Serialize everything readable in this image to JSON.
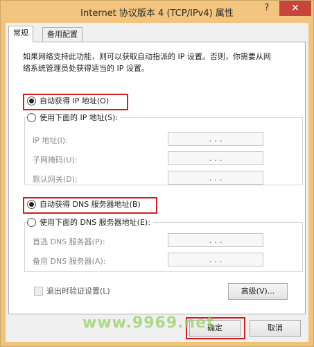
{
  "window": {
    "title": "Internet 协议版本 4 (TCP/IPv4) 属性",
    "help": "?",
    "close": "✕"
  },
  "tabs": [
    "常规",
    "备用配置"
  ],
  "description_lines": [
    "如果网络支持此功能，则可以获取自动指派的 IP 设置。否则，你需要从网",
    "络系统管理员处获得适当的 IP 设置。"
  ],
  "ip_section": {
    "auto_label": "自动获得 IP 地址(O)",
    "manual_label": "使用下面的 IP 地址(S):",
    "selected": "auto",
    "fields": [
      {
        "label": "IP 地址(I):",
        "value": ".  .  ."
      },
      {
        "label": "子网掩码(U):",
        "value": ".  .  ."
      },
      {
        "label": "默认网关(D):",
        "value": ".  .  ."
      }
    ]
  },
  "dns_section": {
    "auto_label": "自动获得 DNS 服务器地址(B)",
    "manual_label": "使用下面的 DNS 服务器地址(E):",
    "selected": "auto",
    "fields": [
      {
        "label": "首选 DNS 服务器(P):",
        "value": ".  .  ."
      },
      {
        "label": "备用 DNS 服务器(A):",
        "value": ".  .  ."
      }
    ]
  },
  "validate_label": "退出时验证设置(L)",
  "buttons": {
    "advanced": "高级(V)...",
    "ok": "确定",
    "cancel": "取消"
  },
  "watermark": "www.9969.net",
  "colors": {
    "titlebar": "#f2c47d",
    "highlight": "#cc1f24",
    "close": "#c7453b"
  }
}
